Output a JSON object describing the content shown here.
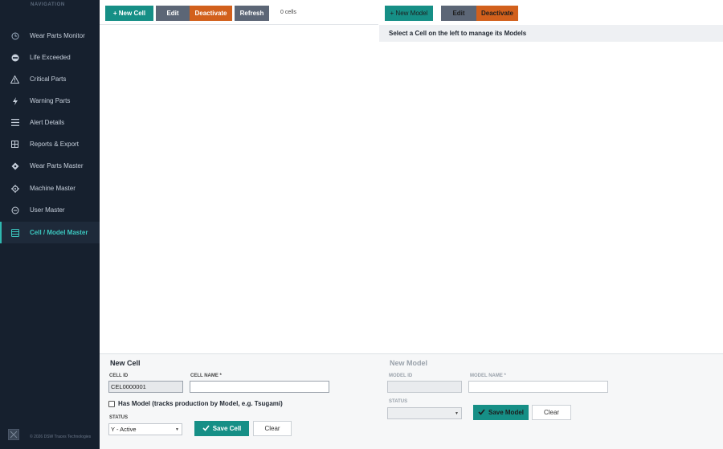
{
  "sidebar": {
    "heading": "NAVIGATION",
    "items": [
      {
        "label": "Wear Parts Monitor",
        "icon": "clock-icon"
      },
      {
        "label": "Life Exceeded",
        "icon": "no-entry-icon"
      },
      {
        "label": "Critical Parts",
        "icon": "warning-triangle-icon"
      },
      {
        "label": "Warning Parts",
        "icon": "lightning-icon"
      },
      {
        "label": "Alert Details",
        "icon": "list-icon"
      },
      {
        "label": "Reports & Export",
        "icon": "grid-icon"
      },
      {
        "label": "Wear Parts Master",
        "icon": "diamond-icon"
      },
      {
        "label": "Machine Master",
        "icon": "gear-icon"
      },
      {
        "label": "User Master",
        "icon": "user-circle-icon"
      },
      {
        "label": "Cell / Model Master",
        "icon": "database-icon",
        "active": true
      }
    ],
    "footer": "© 2026 DSW Traces Technologies"
  },
  "cells_toolbar": {
    "new_label": "+ New Cell",
    "edit_label": "Edit",
    "deactivate_label": "Deactivate",
    "refresh_label": "Refresh",
    "count": "0 cells"
  },
  "models_toolbar": {
    "new_label": "+ New Model",
    "edit_label": "Edit",
    "deactivate_label": "Deactivate"
  },
  "models_panel": {
    "header": "Select a Cell on the left to manage its Models"
  },
  "cell_form": {
    "title": "New Cell",
    "cell_id_label": "CELL ID",
    "cell_id_value": "CEL0000001",
    "cell_name_label": "CELL NAME *",
    "cell_name_value": "",
    "has_model_label": "Has Model (tracks production by Model, e.g. Tsugami)",
    "has_model_checked": false,
    "status_label": "STATUS",
    "status_value": "Y - Active",
    "save_label": "Save Cell",
    "clear_label": "Clear"
  },
  "model_form": {
    "title": "New Model",
    "model_id_label": "MODEL ID",
    "model_id_value": "",
    "model_name_label": "MODEL NAME *",
    "model_name_value": "",
    "status_label": "STATUS",
    "status_value": "",
    "save_label": "Save Model",
    "clear_label": "Clear"
  },
  "colors": {
    "sidebar_bg": "#16202e",
    "accent_teal": "#168f86",
    "gray_button": "#5c6676",
    "orange_button": "#d2601c"
  }
}
